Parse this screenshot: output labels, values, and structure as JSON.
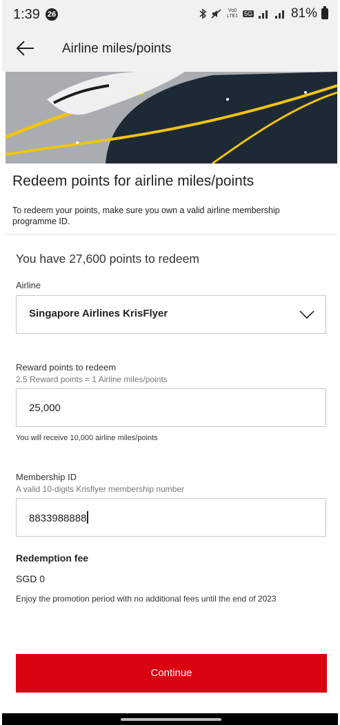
{
  "status_bar": {
    "time": "1:39",
    "notification_count": "26",
    "network_labels": [
      "Vo0 LTE1",
      "5G"
    ],
    "battery": "81%"
  },
  "header": {
    "title": "Airline miles/points"
  },
  "intro": {
    "heading": "Redeem points for airline miles/points",
    "text": "To redeem your points, make sure you own a valid airline membership programme ID."
  },
  "form": {
    "points_summary": "You have 27,600 points to redeem",
    "airline": {
      "label": "Airline",
      "selected": "Singapore Airlines KrisFlyer"
    },
    "reward_points": {
      "label": "Reward points to redeem",
      "hint": "2.5 Reward points = 1 Airline miles/points",
      "value": "25,000",
      "note": "You will receive 10,000 airline miles/points"
    },
    "membership": {
      "label": "Membership ID",
      "hint": "A valid 10-digits Krisflyer membership number",
      "value": "8833988888"
    },
    "fee": {
      "label": "Redemption fee",
      "value": "SGD 0",
      "note": "Enjoy the promotion period with no additional fees until the end of 2023"
    }
  },
  "actions": {
    "continue_label": "Continue"
  },
  "colors": {
    "primary": "#db0011",
    "header_bg": "#f1f1f1"
  }
}
